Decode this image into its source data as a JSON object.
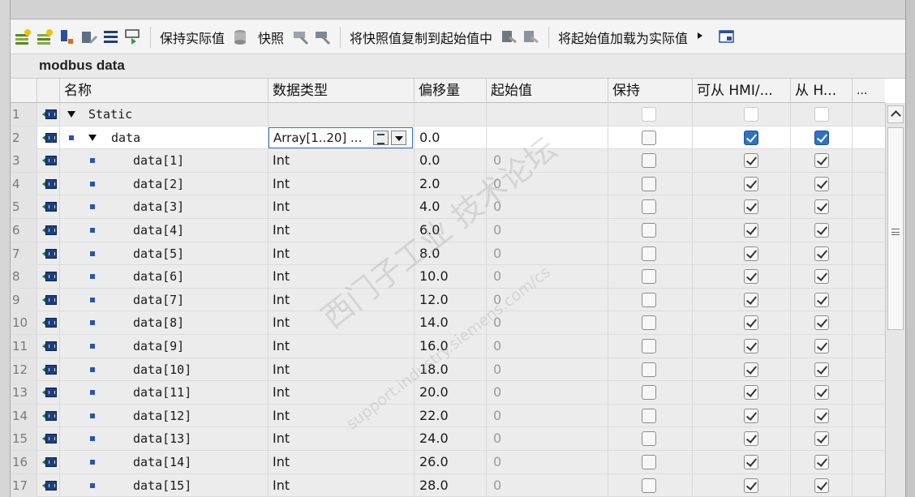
{
  "toolbar": {
    "keep_actual_label": "保持实际值",
    "snapshot_label": "快照",
    "copy_snapshot_label": "将快照值复制到起始值中",
    "load_start_label": "将起始值加载为实际值"
  },
  "block": {
    "name": "modbus data"
  },
  "columns": {
    "name": "名称",
    "type": "数据类型",
    "offset": "偏移量",
    "start": "起始值",
    "retain": "保持",
    "hmi": "可从 HMI/...",
    "from": "从 H...",
    "more": "..."
  },
  "rows": [
    {
      "num": "1",
      "name": "Static",
      "type": "",
      "offset": "",
      "start": "",
      "retain": false,
      "hmi": false,
      "from": false
    },
    {
      "num": "2",
      "name": "data",
      "type": "Array[1..20] ...",
      "offset": "0.0",
      "start": "",
      "retain": false,
      "hmi": true,
      "from": true
    },
    {
      "num": "3",
      "name": "data[1]",
      "type": "Int",
      "offset": "0.0",
      "start": "0",
      "retain": false,
      "hmi": true,
      "from": true
    },
    {
      "num": "4",
      "name": "data[2]",
      "type": "Int",
      "offset": "2.0",
      "start": "0",
      "retain": false,
      "hmi": true,
      "from": true
    },
    {
      "num": "5",
      "name": "data[3]",
      "type": "Int",
      "offset": "4.0",
      "start": "0",
      "retain": false,
      "hmi": true,
      "from": true
    },
    {
      "num": "6",
      "name": "data[4]",
      "type": "Int",
      "offset": "6.0",
      "start": "0",
      "retain": false,
      "hmi": true,
      "from": true
    },
    {
      "num": "7",
      "name": "data[5]",
      "type": "Int",
      "offset": "8.0",
      "start": "0",
      "retain": false,
      "hmi": true,
      "from": true
    },
    {
      "num": "8",
      "name": "data[6]",
      "type": "Int",
      "offset": "10.0",
      "start": "0",
      "retain": false,
      "hmi": true,
      "from": true
    },
    {
      "num": "9",
      "name": "data[7]",
      "type": "Int",
      "offset": "12.0",
      "start": "0",
      "retain": false,
      "hmi": true,
      "from": true
    },
    {
      "num": "10",
      "name": "data[8]",
      "type": "Int",
      "offset": "14.0",
      "start": "0",
      "retain": false,
      "hmi": true,
      "from": true
    },
    {
      "num": "11",
      "name": "data[9]",
      "type": "Int",
      "offset": "16.0",
      "start": "0",
      "retain": false,
      "hmi": true,
      "from": true
    },
    {
      "num": "12",
      "name": "data[10]",
      "type": "Int",
      "offset": "18.0",
      "start": "0",
      "retain": false,
      "hmi": true,
      "from": true
    },
    {
      "num": "13",
      "name": "data[11]",
      "type": "Int",
      "offset": "20.0",
      "start": "0",
      "retain": false,
      "hmi": true,
      "from": true
    },
    {
      "num": "14",
      "name": "data[12]",
      "type": "Int",
      "offset": "22.0",
      "start": "0",
      "retain": false,
      "hmi": true,
      "from": true
    },
    {
      "num": "15",
      "name": "data[13]",
      "type": "Int",
      "offset": "24.0",
      "start": "0",
      "retain": false,
      "hmi": true,
      "from": true
    },
    {
      "num": "16",
      "name": "data[14]",
      "type": "Int",
      "offset": "26.0",
      "start": "0",
      "retain": false,
      "hmi": true,
      "from": true
    },
    {
      "num": "17",
      "name": "data[15]",
      "type": "Int",
      "offset": "28.0",
      "start": "0",
      "retain": false,
      "hmi": true,
      "from": true
    }
  ],
  "watermark": {
    "line1": "西门子工业 技术论坛",
    "line2": "support.industry.siemens.com/cs"
  },
  "colors": {
    "accent": "#2f73c6",
    "icon_blue": "#1f3f7a",
    "icon_green": "#1e7a3c"
  }
}
